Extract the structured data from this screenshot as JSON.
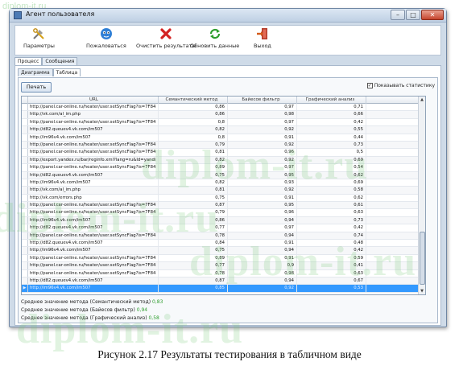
{
  "watermark_top": "diplom-it.ru",
  "watermark_big": "diplom-it.ru",
  "window": {
    "title": "Агент пользователя"
  },
  "toolbar": {
    "items": [
      {
        "label": "Параметры",
        "icon": "tools-icon"
      },
      {
        "label": "Пожаловаться",
        "icon": "face-icon"
      },
      {
        "label": "Очистить результаты",
        "icon": "clear-icon"
      },
      {
        "label": "Обновить данные",
        "icon": "refresh-icon"
      },
      {
        "label": "Выход",
        "icon": "exit-icon"
      }
    ]
  },
  "tabs_outer": [
    "Процесс",
    "Сообщения"
  ],
  "tabs_inner": [
    "Диаграмма",
    "Таблица"
  ],
  "print_button": "Печать",
  "show_stats_label": "Показывать статистику",
  "show_stats_checked": true,
  "table": {
    "columns": [
      "URL",
      "Семантический метод",
      "Байесов фильтр",
      "Графический анализ"
    ],
    "rows": [
      [
        "http://panel.car-online.ru/heater/user.setSyncFlag?is=7F84",
        "0,86",
        "0,97",
        "0,71"
      ],
      [
        "http://vk.com/al_im.php",
        "0,86",
        "0,98",
        "0,66"
      ],
      [
        "http://panel.car-online.ru/heater/user.setSyncFlag?is=7F84",
        "0,8",
        "0,97",
        "0,42"
      ],
      [
        "http://d82.queuev4.vk.com/im507",
        "0,82",
        "0,92",
        "0,55"
      ],
      [
        "http://im96v4.vk.com/im507",
        "0,8",
        "0,91",
        "0,44"
      ],
      [
        "http://panel.car-online.ru/heater/user.setSyncFlag?is=7F84",
        "0,79",
        "0,92",
        "0,73"
      ],
      [
        "http://panel.car-online.ru/heater/user.setSyncFlag?is=7F84",
        "0,81",
        "0,96",
        "0,5"
      ],
      [
        "http://export.yandex.ru/bar/reginfo.xml?lang=ru&Id=yandi",
        "0,82",
        "0,92",
        "0,69"
      ],
      [
        "http://panel.car-online.ru/heater/user.setSyncFlag?is=7F84",
        "0,89",
        "0,97",
        "0,54"
      ],
      [
        "http://d82.queuev4.vk.com/im507",
        "0,75",
        "0,95",
        "0,62"
      ],
      [
        "http://im96v4.vk.com/im507",
        "0,82",
        "0,93",
        "0,69"
      ],
      [
        "http://vk.com/al_im.php",
        "0,81",
        "0,92",
        "0,58"
      ],
      [
        "http://vk.com/errors.php",
        "0,75",
        "0,91",
        "0,62"
      ],
      [
        "http://panel.car-online.ru/heater/user.setSyncFlag?is=7F84",
        "0,87",
        "0,95",
        "0,61"
      ],
      [
        "http://panel.car-online.ru/heater/user.setSyncFlag?is=7F84",
        "0,79",
        "0,96",
        "0,63"
      ],
      [
        "http://im96v4.vk.com/im507",
        "0,86",
        "0,94",
        "0,73"
      ],
      [
        "http://d82.queuev4.vk.com/im507",
        "0,77",
        "0,97",
        "0,42"
      ],
      [
        "http://panel.car-online.ru/heater/user.setSyncFlag?is=7F84",
        "0,78",
        "0,94",
        "0,74"
      ],
      [
        "http://d82.queuev4.vk.com/im507",
        "0,84",
        "0,91",
        "0,48"
      ],
      [
        "http://im96v4.vk.com/im507",
        "0,75",
        "0,94",
        "0,42"
      ],
      [
        "http://panel.car-online.ru/heater/user.setSyncFlag?is=7F84",
        "0,89",
        "0,91",
        "0,59"
      ],
      [
        "http://panel.car-online.ru/heater/user.setSyncFlag?is=7F84",
        "0,77",
        "0,9",
        "0,41"
      ],
      [
        "http://panel.car-online.ru/heater/user.setSyncFlag?is=7F84",
        "0,78",
        "0,98",
        "0,63"
      ],
      [
        "http://d82.queuev4.vk.com/im507",
        "0,87",
        "0,94",
        "0,67"
      ],
      [
        "http://im96v4.vk.com/im507",
        "0,85",
        "0,92",
        "0,53"
      ]
    ],
    "selected_row": 24
  },
  "stats": [
    {
      "label": "Среднее значение метода (Семантический метод)",
      "value": "0,83"
    },
    {
      "label": "Среднее значение метода (Байесов фильтр)",
      "value": "0,94"
    },
    {
      "label": "Среднее значение метода (Графический анализ)",
      "value": "0,58"
    }
  ],
  "caption": "Рисунок 2.17 Результаты тестирования в табличном виде"
}
